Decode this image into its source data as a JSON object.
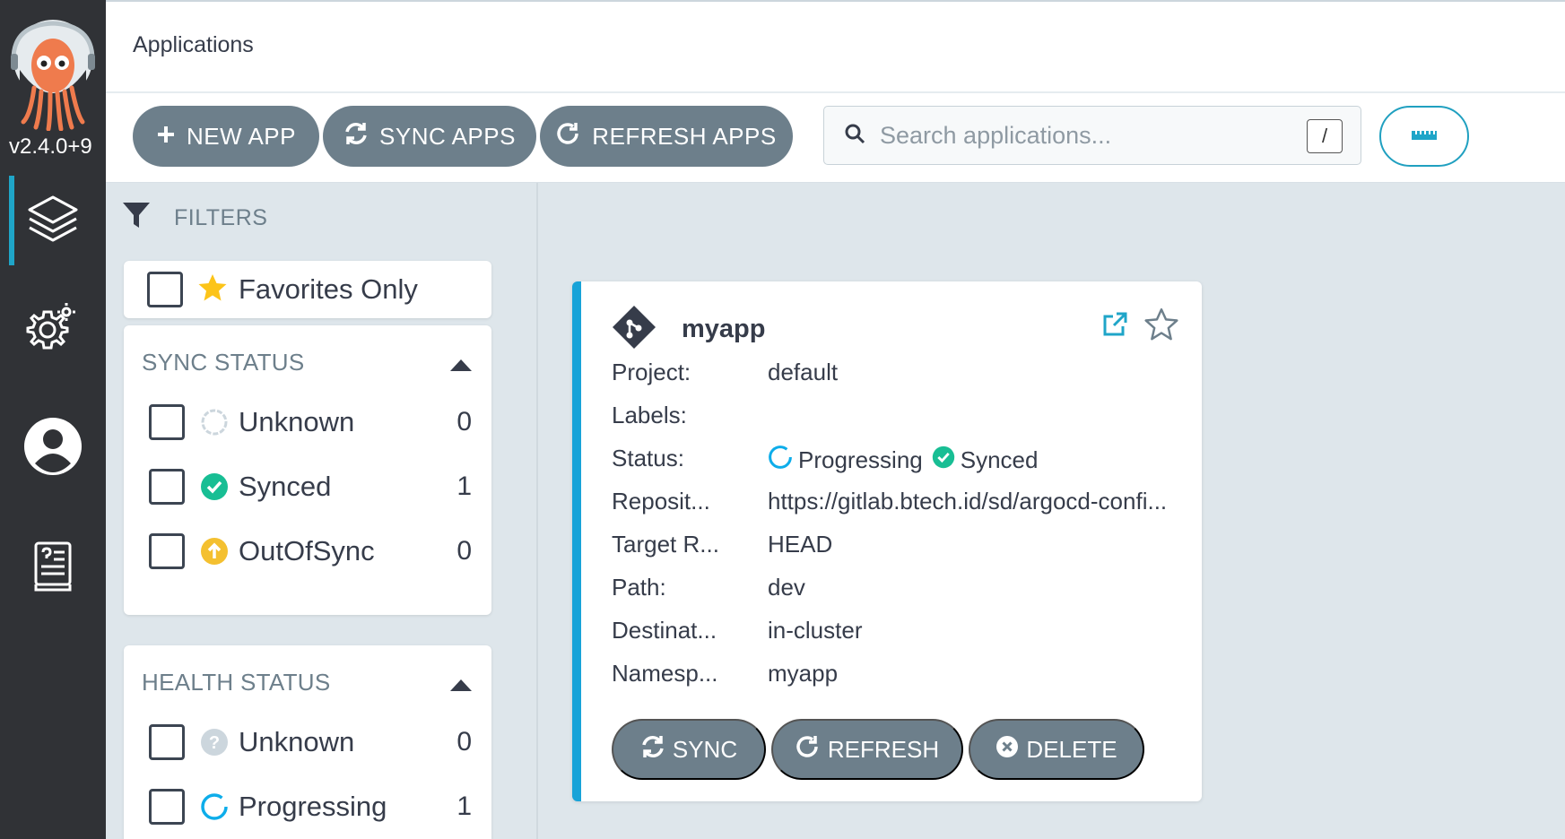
{
  "app": {
    "version": "v2.4.0+9"
  },
  "header": {
    "title": "Applications"
  },
  "toolbar": {
    "new_app": "NEW APP",
    "sync_apps": "SYNC APPS",
    "refresh_apps": "REFRESH APPS",
    "search_placeholder": "Search applications...",
    "search_shortcut": "/"
  },
  "filters": {
    "title": "FILTERS",
    "favorites_label": "Favorites Only",
    "sync_status": {
      "title": "SYNC STATUS",
      "items": [
        {
          "label": "Unknown",
          "count": "0",
          "icon": "unknown-circle-icon",
          "color": "#ccd6dd"
        },
        {
          "label": "Synced",
          "count": "1",
          "icon": "check-circle-icon",
          "color": "#18be94"
        },
        {
          "label": "OutOfSync",
          "count": "0",
          "icon": "arrow-up-circle-icon",
          "color": "#f4c030"
        }
      ]
    },
    "health_status": {
      "title": "HEALTH STATUS",
      "items": [
        {
          "label": "Unknown",
          "count": "0",
          "icon": "question-circle-icon",
          "color": "#ccd6dd"
        },
        {
          "label": "Progressing",
          "count": "1",
          "icon": "progress-circle-icon",
          "color": "#0dadea"
        }
      ]
    }
  },
  "tile": {
    "name": "myapp",
    "fields": [
      {
        "key": "Project:",
        "value": "default"
      },
      {
        "key": "Labels:",
        "value": ""
      },
      {
        "key": "Status:",
        "value": ""
      },
      {
        "key": "Reposit...",
        "value": "https://gitlab.btech.id/sd/argocd-confi..."
      },
      {
        "key": "Target R...",
        "value": "HEAD"
      },
      {
        "key": "Path:",
        "value": "dev"
      },
      {
        "key": "Destinat...",
        "value": "in-cluster"
      },
      {
        "key": "Namesp...",
        "value": "myapp"
      }
    ],
    "health": "Progressing",
    "sync": "Synced",
    "buttons": {
      "sync": "SYNC",
      "refresh": "REFRESH",
      "delete": "DELETE"
    }
  },
  "colors": {
    "accent": "#18a3d8",
    "button": "#6d7f8b",
    "sidebar": "#303236",
    "synced": "#18be94",
    "progressing": "#0dadea"
  }
}
